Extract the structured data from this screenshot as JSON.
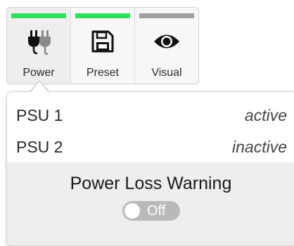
{
  "toolbar": {
    "items": [
      {
        "label": "Power",
        "icon": "power-plugs-icon",
        "status_color": "#2ee05a"
      },
      {
        "label": "Preset",
        "icon": "floppy-disk-icon",
        "status_color": "#2ee05a"
      },
      {
        "label": "Visual",
        "icon": "eye-icon",
        "status_color": "#9e9e9e"
      }
    ]
  },
  "power_popover": {
    "psus": [
      {
        "name": "PSU 1",
        "status": "active"
      },
      {
        "name": "PSU 2",
        "status": "inactive"
      }
    ],
    "warning": {
      "title": "Power Loss Warning",
      "toggle_label": "Off",
      "toggle_on": false
    }
  }
}
